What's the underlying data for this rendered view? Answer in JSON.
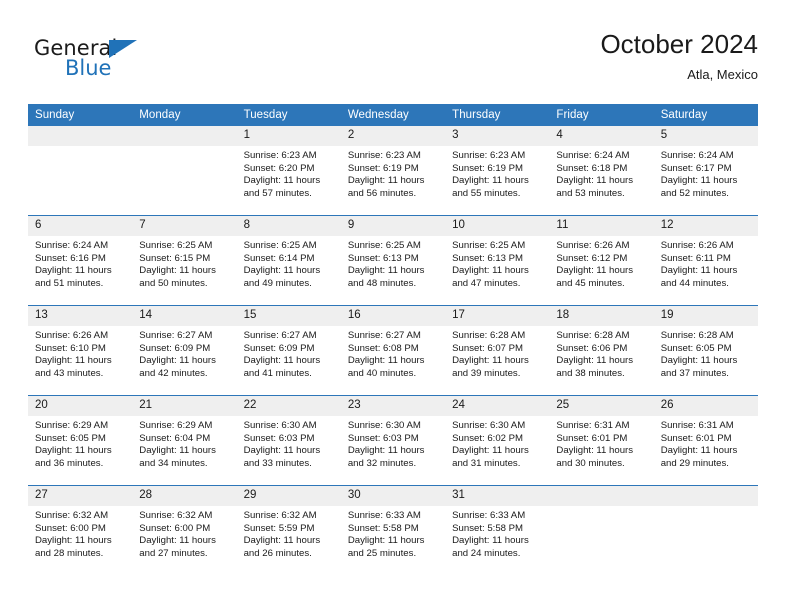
{
  "brand": {
    "word1": "General",
    "word2": "Blue",
    "triangle_color": "#2072b8",
    "icon": "triangle-icon"
  },
  "header": {
    "title": "October 2024",
    "subtitle": "Atla, Mexico"
  },
  "theme": {
    "header_blue": "#2d76b9",
    "daynum_gray": "#efefef",
    "text": "#1a1a1a"
  },
  "weekdays": [
    "Sunday",
    "Monday",
    "Tuesday",
    "Wednesday",
    "Thursday",
    "Friday",
    "Saturday"
  ],
  "weeks": [
    [
      {
        "day": "",
        "sunrise": "",
        "sunset": "",
        "daylight1": "",
        "daylight2": "",
        "blank": true
      },
      {
        "day": "",
        "sunrise": "",
        "sunset": "",
        "daylight1": "",
        "daylight2": "",
        "blank": true
      },
      {
        "day": "1",
        "sunrise": "Sunrise: 6:23 AM",
        "sunset": "Sunset: 6:20 PM",
        "daylight1": "Daylight: 11 hours",
        "daylight2": "and 57 minutes."
      },
      {
        "day": "2",
        "sunrise": "Sunrise: 6:23 AM",
        "sunset": "Sunset: 6:19 PM",
        "daylight1": "Daylight: 11 hours",
        "daylight2": "and 56 minutes."
      },
      {
        "day": "3",
        "sunrise": "Sunrise: 6:23 AM",
        "sunset": "Sunset: 6:19 PM",
        "daylight1": "Daylight: 11 hours",
        "daylight2": "and 55 minutes."
      },
      {
        "day": "4",
        "sunrise": "Sunrise: 6:24 AM",
        "sunset": "Sunset: 6:18 PM",
        "daylight1": "Daylight: 11 hours",
        "daylight2": "and 53 minutes."
      },
      {
        "day": "5",
        "sunrise": "Sunrise: 6:24 AM",
        "sunset": "Sunset: 6:17 PM",
        "daylight1": "Daylight: 11 hours",
        "daylight2": "and 52 minutes."
      }
    ],
    [
      {
        "day": "6",
        "sunrise": "Sunrise: 6:24 AM",
        "sunset": "Sunset: 6:16 PM",
        "daylight1": "Daylight: 11 hours",
        "daylight2": "and 51 minutes."
      },
      {
        "day": "7",
        "sunrise": "Sunrise: 6:25 AM",
        "sunset": "Sunset: 6:15 PM",
        "daylight1": "Daylight: 11 hours",
        "daylight2": "and 50 minutes."
      },
      {
        "day": "8",
        "sunrise": "Sunrise: 6:25 AM",
        "sunset": "Sunset: 6:14 PM",
        "daylight1": "Daylight: 11 hours",
        "daylight2": "and 49 minutes."
      },
      {
        "day": "9",
        "sunrise": "Sunrise: 6:25 AM",
        "sunset": "Sunset: 6:13 PM",
        "daylight1": "Daylight: 11 hours",
        "daylight2": "and 48 minutes."
      },
      {
        "day": "10",
        "sunrise": "Sunrise: 6:25 AM",
        "sunset": "Sunset: 6:13 PM",
        "daylight1": "Daylight: 11 hours",
        "daylight2": "and 47 minutes."
      },
      {
        "day": "11",
        "sunrise": "Sunrise: 6:26 AM",
        "sunset": "Sunset: 6:12 PM",
        "daylight1": "Daylight: 11 hours",
        "daylight2": "and 45 minutes."
      },
      {
        "day": "12",
        "sunrise": "Sunrise: 6:26 AM",
        "sunset": "Sunset: 6:11 PM",
        "daylight1": "Daylight: 11 hours",
        "daylight2": "and 44 minutes."
      }
    ],
    [
      {
        "day": "13",
        "sunrise": "Sunrise: 6:26 AM",
        "sunset": "Sunset: 6:10 PM",
        "daylight1": "Daylight: 11 hours",
        "daylight2": "and 43 minutes."
      },
      {
        "day": "14",
        "sunrise": "Sunrise: 6:27 AM",
        "sunset": "Sunset: 6:09 PM",
        "daylight1": "Daylight: 11 hours",
        "daylight2": "and 42 minutes."
      },
      {
        "day": "15",
        "sunrise": "Sunrise: 6:27 AM",
        "sunset": "Sunset: 6:09 PM",
        "daylight1": "Daylight: 11 hours",
        "daylight2": "and 41 minutes."
      },
      {
        "day": "16",
        "sunrise": "Sunrise: 6:27 AM",
        "sunset": "Sunset: 6:08 PM",
        "daylight1": "Daylight: 11 hours",
        "daylight2": "and 40 minutes."
      },
      {
        "day": "17",
        "sunrise": "Sunrise: 6:28 AM",
        "sunset": "Sunset: 6:07 PM",
        "daylight1": "Daylight: 11 hours",
        "daylight2": "and 39 minutes."
      },
      {
        "day": "18",
        "sunrise": "Sunrise: 6:28 AM",
        "sunset": "Sunset: 6:06 PM",
        "daylight1": "Daylight: 11 hours",
        "daylight2": "and 38 minutes."
      },
      {
        "day": "19",
        "sunrise": "Sunrise: 6:28 AM",
        "sunset": "Sunset: 6:05 PM",
        "daylight1": "Daylight: 11 hours",
        "daylight2": "and 37 minutes."
      }
    ],
    [
      {
        "day": "20",
        "sunrise": "Sunrise: 6:29 AM",
        "sunset": "Sunset: 6:05 PM",
        "daylight1": "Daylight: 11 hours",
        "daylight2": "and 36 minutes."
      },
      {
        "day": "21",
        "sunrise": "Sunrise: 6:29 AM",
        "sunset": "Sunset: 6:04 PM",
        "daylight1": "Daylight: 11 hours",
        "daylight2": "and 34 minutes."
      },
      {
        "day": "22",
        "sunrise": "Sunrise: 6:30 AM",
        "sunset": "Sunset: 6:03 PM",
        "daylight1": "Daylight: 11 hours",
        "daylight2": "and 33 minutes."
      },
      {
        "day": "23",
        "sunrise": "Sunrise: 6:30 AM",
        "sunset": "Sunset: 6:03 PM",
        "daylight1": "Daylight: 11 hours",
        "daylight2": "and 32 minutes."
      },
      {
        "day": "24",
        "sunrise": "Sunrise: 6:30 AM",
        "sunset": "Sunset: 6:02 PM",
        "daylight1": "Daylight: 11 hours",
        "daylight2": "and 31 minutes."
      },
      {
        "day": "25",
        "sunrise": "Sunrise: 6:31 AM",
        "sunset": "Sunset: 6:01 PM",
        "daylight1": "Daylight: 11 hours",
        "daylight2": "and 30 minutes."
      },
      {
        "day": "26",
        "sunrise": "Sunrise: 6:31 AM",
        "sunset": "Sunset: 6:01 PM",
        "daylight1": "Daylight: 11 hours",
        "daylight2": "and 29 minutes."
      }
    ],
    [
      {
        "day": "27",
        "sunrise": "Sunrise: 6:32 AM",
        "sunset": "Sunset: 6:00 PM",
        "daylight1": "Daylight: 11 hours",
        "daylight2": "and 28 minutes."
      },
      {
        "day": "28",
        "sunrise": "Sunrise: 6:32 AM",
        "sunset": "Sunset: 6:00 PM",
        "daylight1": "Daylight: 11 hours",
        "daylight2": "and 27 minutes."
      },
      {
        "day": "29",
        "sunrise": "Sunrise: 6:32 AM",
        "sunset": "Sunset: 5:59 PM",
        "daylight1": "Daylight: 11 hours",
        "daylight2": "and 26 minutes."
      },
      {
        "day": "30",
        "sunrise": "Sunrise: 6:33 AM",
        "sunset": "Sunset: 5:58 PM",
        "daylight1": "Daylight: 11 hours",
        "daylight2": "and 25 minutes."
      },
      {
        "day": "31",
        "sunrise": "Sunrise: 6:33 AM",
        "sunset": "Sunset: 5:58 PM",
        "daylight1": "Daylight: 11 hours",
        "daylight2": "and 24 minutes."
      },
      {
        "day": "",
        "sunrise": "",
        "sunset": "",
        "daylight1": "",
        "daylight2": "",
        "blank": true
      },
      {
        "day": "",
        "sunrise": "",
        "sunset": "",
        "daylight1": "",
        "daylight2": "",
        "blank": true
      }
    ]
  ]
}
